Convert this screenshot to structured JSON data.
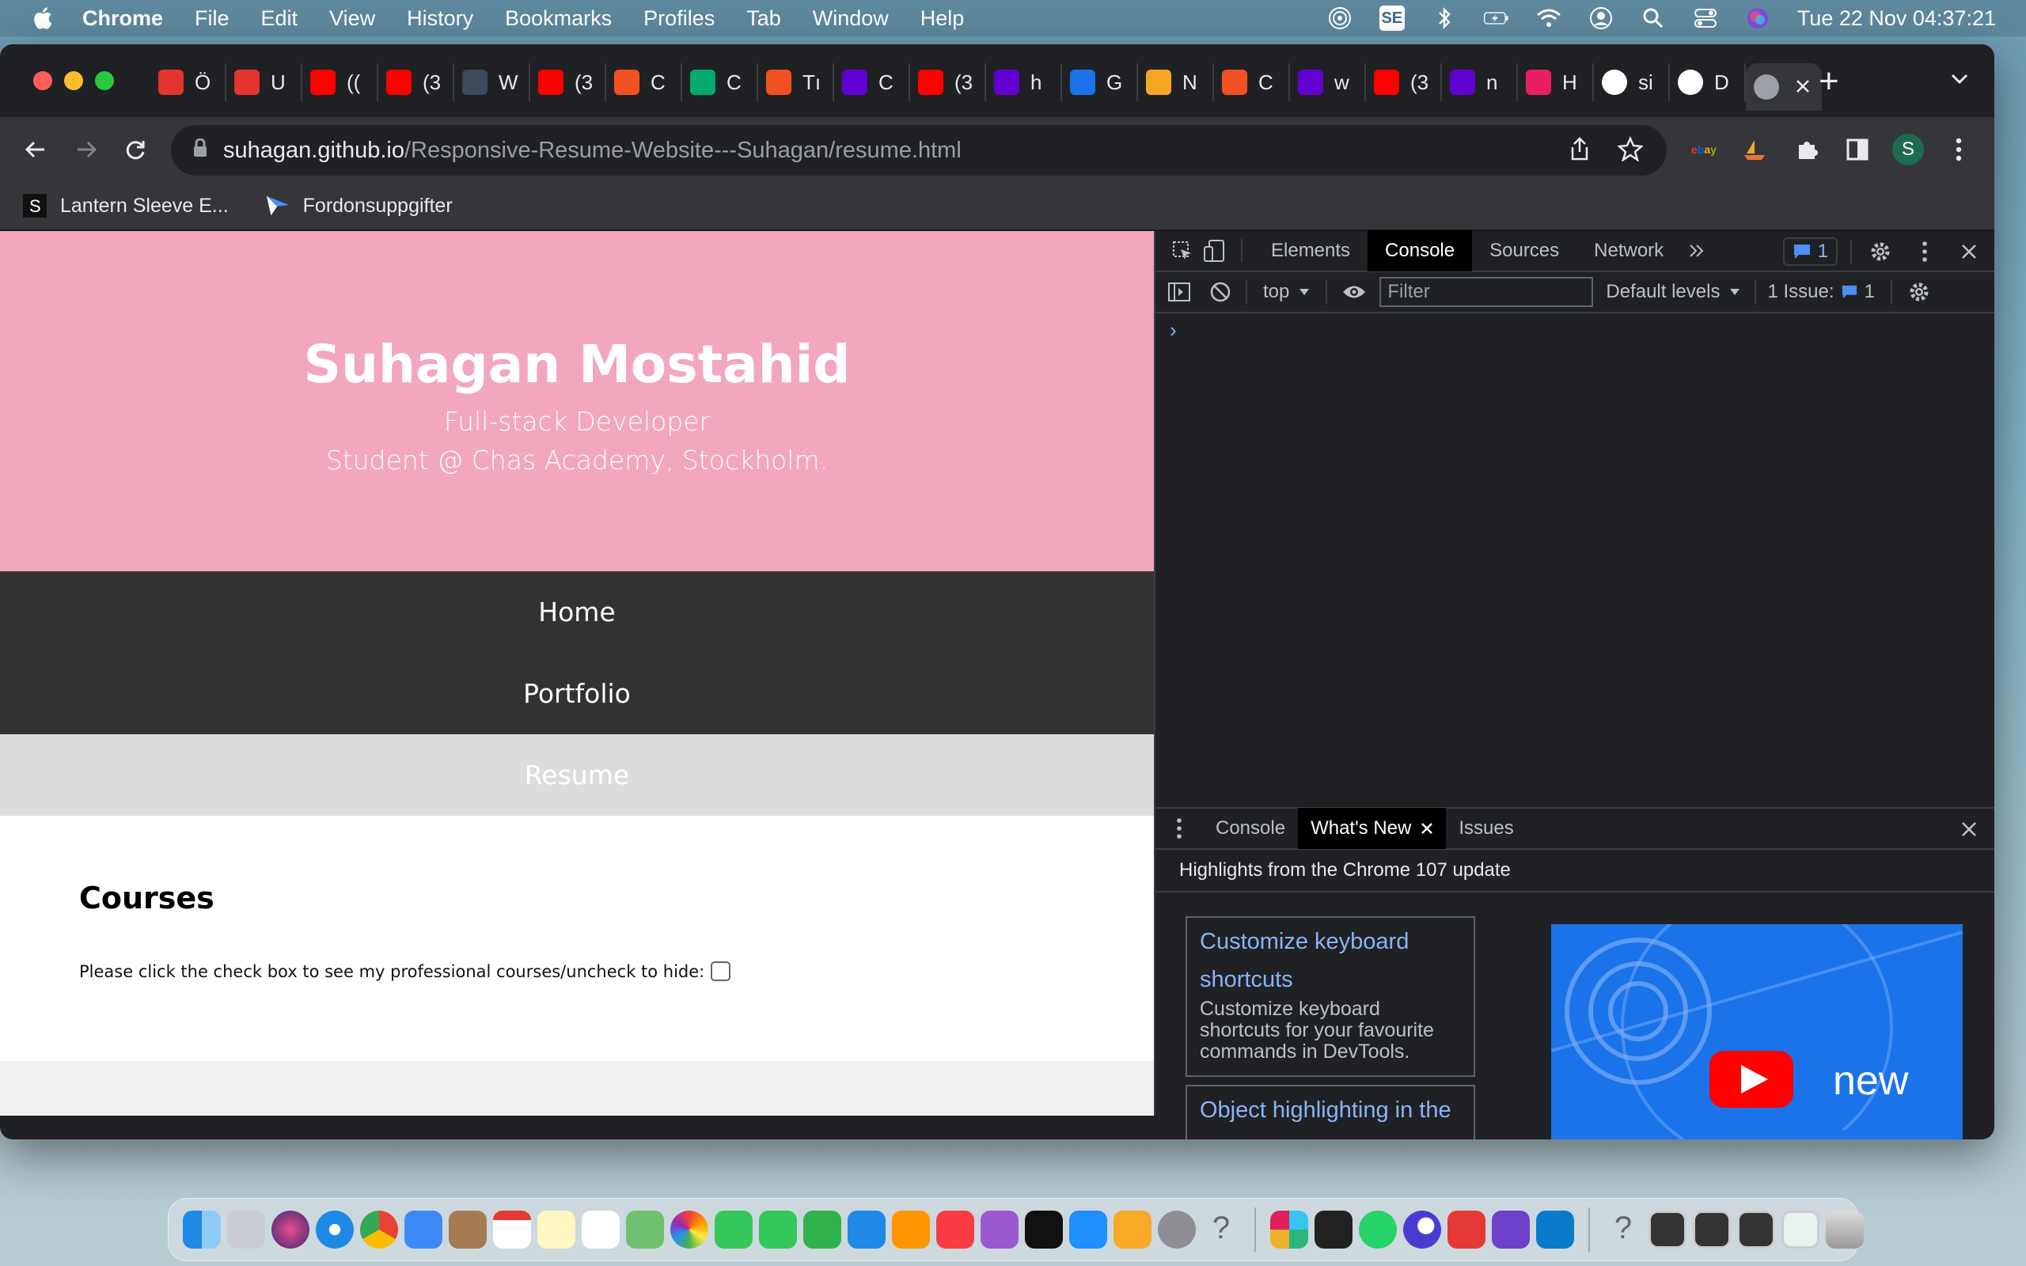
{
  "menubar": {
    "app_name": "Chrome",
    "items": [
      "File",
      "Edit",
      "View",
      "History",
      "Bookmarks",
      "Profiles",
      "Tab",
      "Window",
      "Help"
    ],
    "input_source": "SE",
    "clock": "Tue 22 Nov  04:37:21"
  },
  "tabs": [
    {
      "icon": "asterisk-red-icon",
      "label": "Ö",
      "color": "#e3342f"
    },
    {
      "icon": "asterisk-red-icon",
      "label": "U",
      "color": "#e3342f"
    },
    {
      "icon": "youtube-icon",
      "label": "((",
      "color": "#ff0000"
    },
    {
      "icon": "youtube-icon",
      "label": "(3",
      "color": "#ff0000"
    },
    {
      "icon": "doc-icon",
      "label": "W",
      "color": "#3c4a5c"
    },
    {
      "icon": "youtube-icon",
      "label": "(3",
      "color": "#ff0000"
    },
    {
      "icon": "microsoft-icon",
      "label": "C",
      "color": "#f25022"
    },
    {
      "icon": "w3-icon",
      "label": "C",
      "color": "#04aa6d"
    },
    {
      "icon": "microsoft-icon",
      "label": "Tı",
      "color": "#f25022"
    },
    {
      "icon": "yahoo-icon",
      "label": "C",
      "color": "#6001d2"
    },
    {
      "icon": "youtube-icon",
      "label": "(3",
      "color": "#ff0000"
    },
    {
      "icon": "yahoo-icon",
      "label": "h",
      "color": "#6001d2"
    },
    {
      "icon": "feather-icon",
      "label": "G",
      "color": "#1a73e8"
    },
    {
      "icon": "boat-icon",
      "label": "N",
      "color": "#f5a623"
    },
    {
      "icon": "microsoft-icon",
      "label": "C",
      "color": "#f25022"
    },
    {
      "icon": "yahoo-icon",
      "label": "w",
      "color": "#6001d2"
    },
    {
      "icon": "youtube-icon",
      "label": "(3",
      "color": "#ff0000"
    },
    {
      "icon": "yahoo-icon",
      "label": "n",
      "color": "#6001d2"
    },
    {
      "icon": "blocks-icon",
      "label": "H",
      "color": "#e91e63"
    },
    {
      "icon": "github-icon",
      "label": "si",
      "color": "#ffffff"
    },
    {
      "icon": "github-icon",
      "label": "D",
      "color": "#ffffff"
    },
    {
      "icon": "globe-icon",
      "label": "",
      "color": "#9aa0a6"
    }
  ],
  "address": {
    "host": "suhagan.github.io",
    "path": "/Responsive-Resume-Website---Suhagan/resume.html"
  },
  "profile_initial": "S",
  "bookmarks": [
    {
      "icon": "s-square-icon",
      "label": "Lantern Sleeve E..."
    },
    {
      "icon": "arrow-logo-icon",
      "label": "Fordonsuppgifter"
    }
  ],
  "page": {
    "name": "Suhagan Mostahid",
    "tagline1": "Full-stack Developer",
    "tagline2": "Student @ Chas Academy, Stockholm.",
    "nav": [
      "Home",
      "Portfolio",
      "Resume"
    ],
    "courses_heading": "Courses",
    "courses_prompt": "Please click the check box to see my professional courses/uncheck to hide:",
    "courses_checked": false
  },
  "devtools": {
    "tabs": [
      "Elements",
      "Console",
      "Sources",
      "Network"
    ],
    "active_tab": "Console",
    "message_count": "1",
    "context": "top",
    "filter_placeholder": "Filter",
    "levels": "Default levels",
    "issues": "1 Issue:",
    "issue_count": "1",
    "drawer_tabs": [
      "Console",
      "What's New",
      "Issues"
    ],
    "drawer_active": "What's New",
    "highlights": "Highlights from the Chrome 107 update",
    "cards": [
      {
        "title": "Customize keyboard shortcuts",
        "desc": "Customize keyboard shortcuts for your favourite commands in DevTools."
      },
      {
        "title": "Object highlighting in the",
        "desc": ""
      }
    ],
    "video_caption": "new"
  },
  "colors": {
    "hero_bg": "#f2a7bd",
    "nav_bg": "#323232",
    "nav_current_bg": "#dcdcdc",
    "devtools_bg": "#202124",
    "link_blue": "#8ab4f8"
  }
}
